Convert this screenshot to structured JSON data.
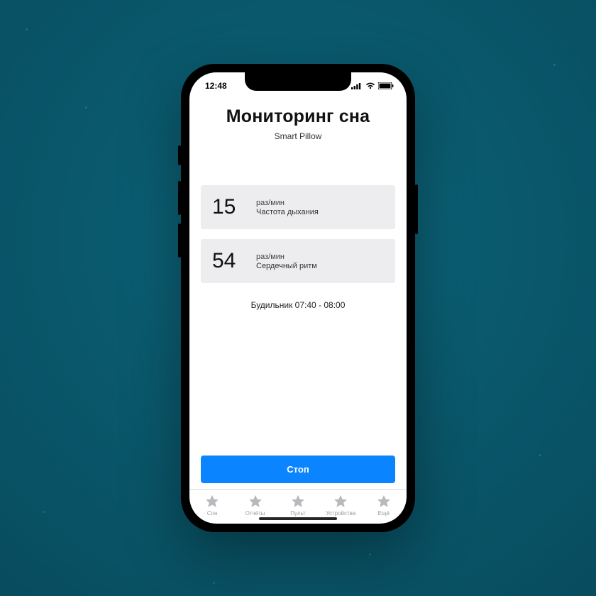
{
  "statusbar": {
    "time": "12:48"
  },
  "header": {
    "title": "Мониторинг сна",
    "subtitle": "Smart Pillow"
  },
  "metrics": {
    "breathing": {
      "value": "15",
      "unit": "раз/мин",
      "label": "Частота дыхания"
    },
    "heart": {
      "value": "54",
      "unit": "раз/мин",
      "label": "Сердечный ритм"
    }
  },
  "alarm": {
    "text": "Будильник 07:40 - 08:00"
  },
  "actions": {
    "stop": "Стоп"
  },
  "tabs": [
    {
      "label": "Сон"
    },
    {
      "label": "Отчёты"
    },
    {
      "label": "Пульт"
    },
    {
      "label": "Устройства"
    },
    {
      "label": "Ещё"
    }
  ],
  "colors": {
    "accent": "#0a84ff",
    "card": "#ededef"
  }
}
